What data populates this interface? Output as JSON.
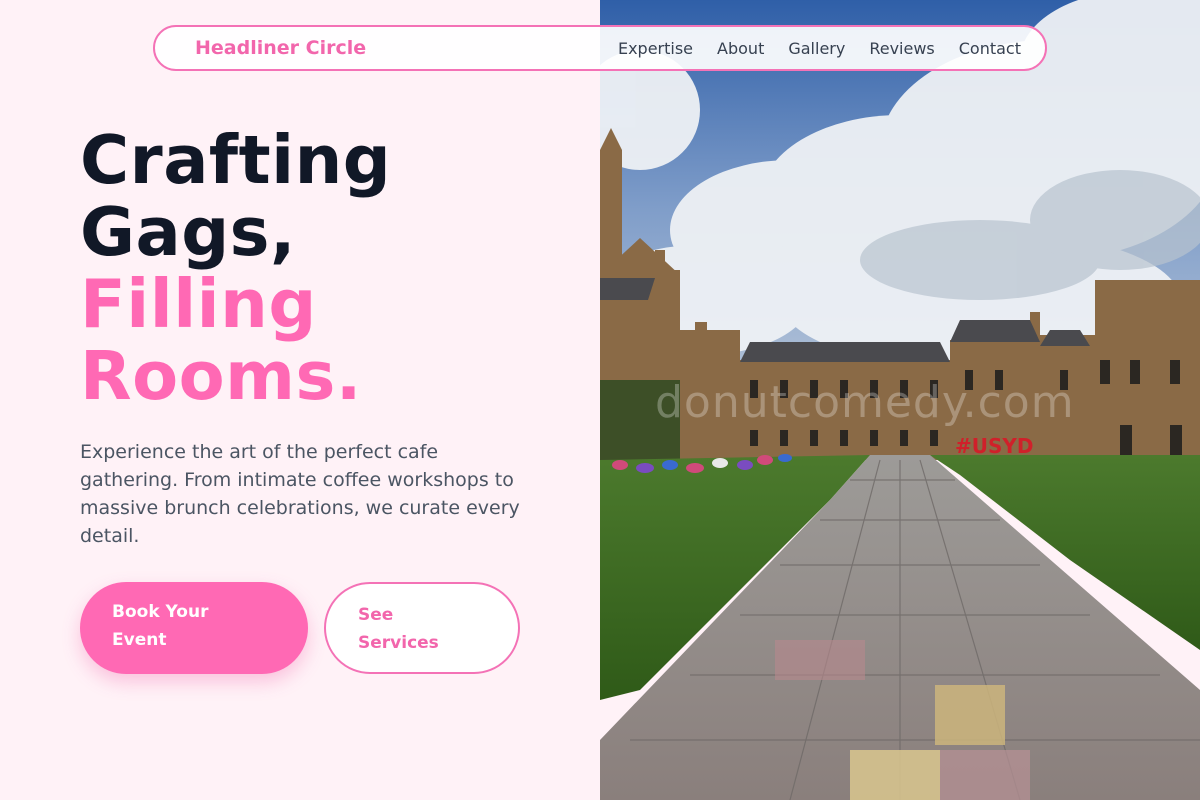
{
  "navbar": {
    "brand": "Headliner Circle",
    "links": [
      "Expertise",
      "About",
      "Gallery",
      "Reviews",
      "Contact"
    ]
  },
  "hero": {
    "headline_dark": [
      "Crafting",
      "Gags,"
    ],
    "headline_pink": [
      "Filling",
      "Rooms."
    ],
    "lead": "Experience the art of the perfect cafe gathering. From intimate coffee workshops to massive brunch celebrations, we curate every detail.",
    "primary_button": [
      "Book Your",
      "Event"
    ],
    "secondary_button": [
      "See",
      "Services"
    ]
  },
  "photo": {
    "watermark": "donutcomedy.com",
    "sign_text": "#USYD"
  },
  "colors": {
    "accent": "#ff69b4",
    "brand_text": "#f266ac",
    "headline_dark": "#111827",
    "body_text": "#4b5563",
    "background": "#fff2f7"
  }
}
